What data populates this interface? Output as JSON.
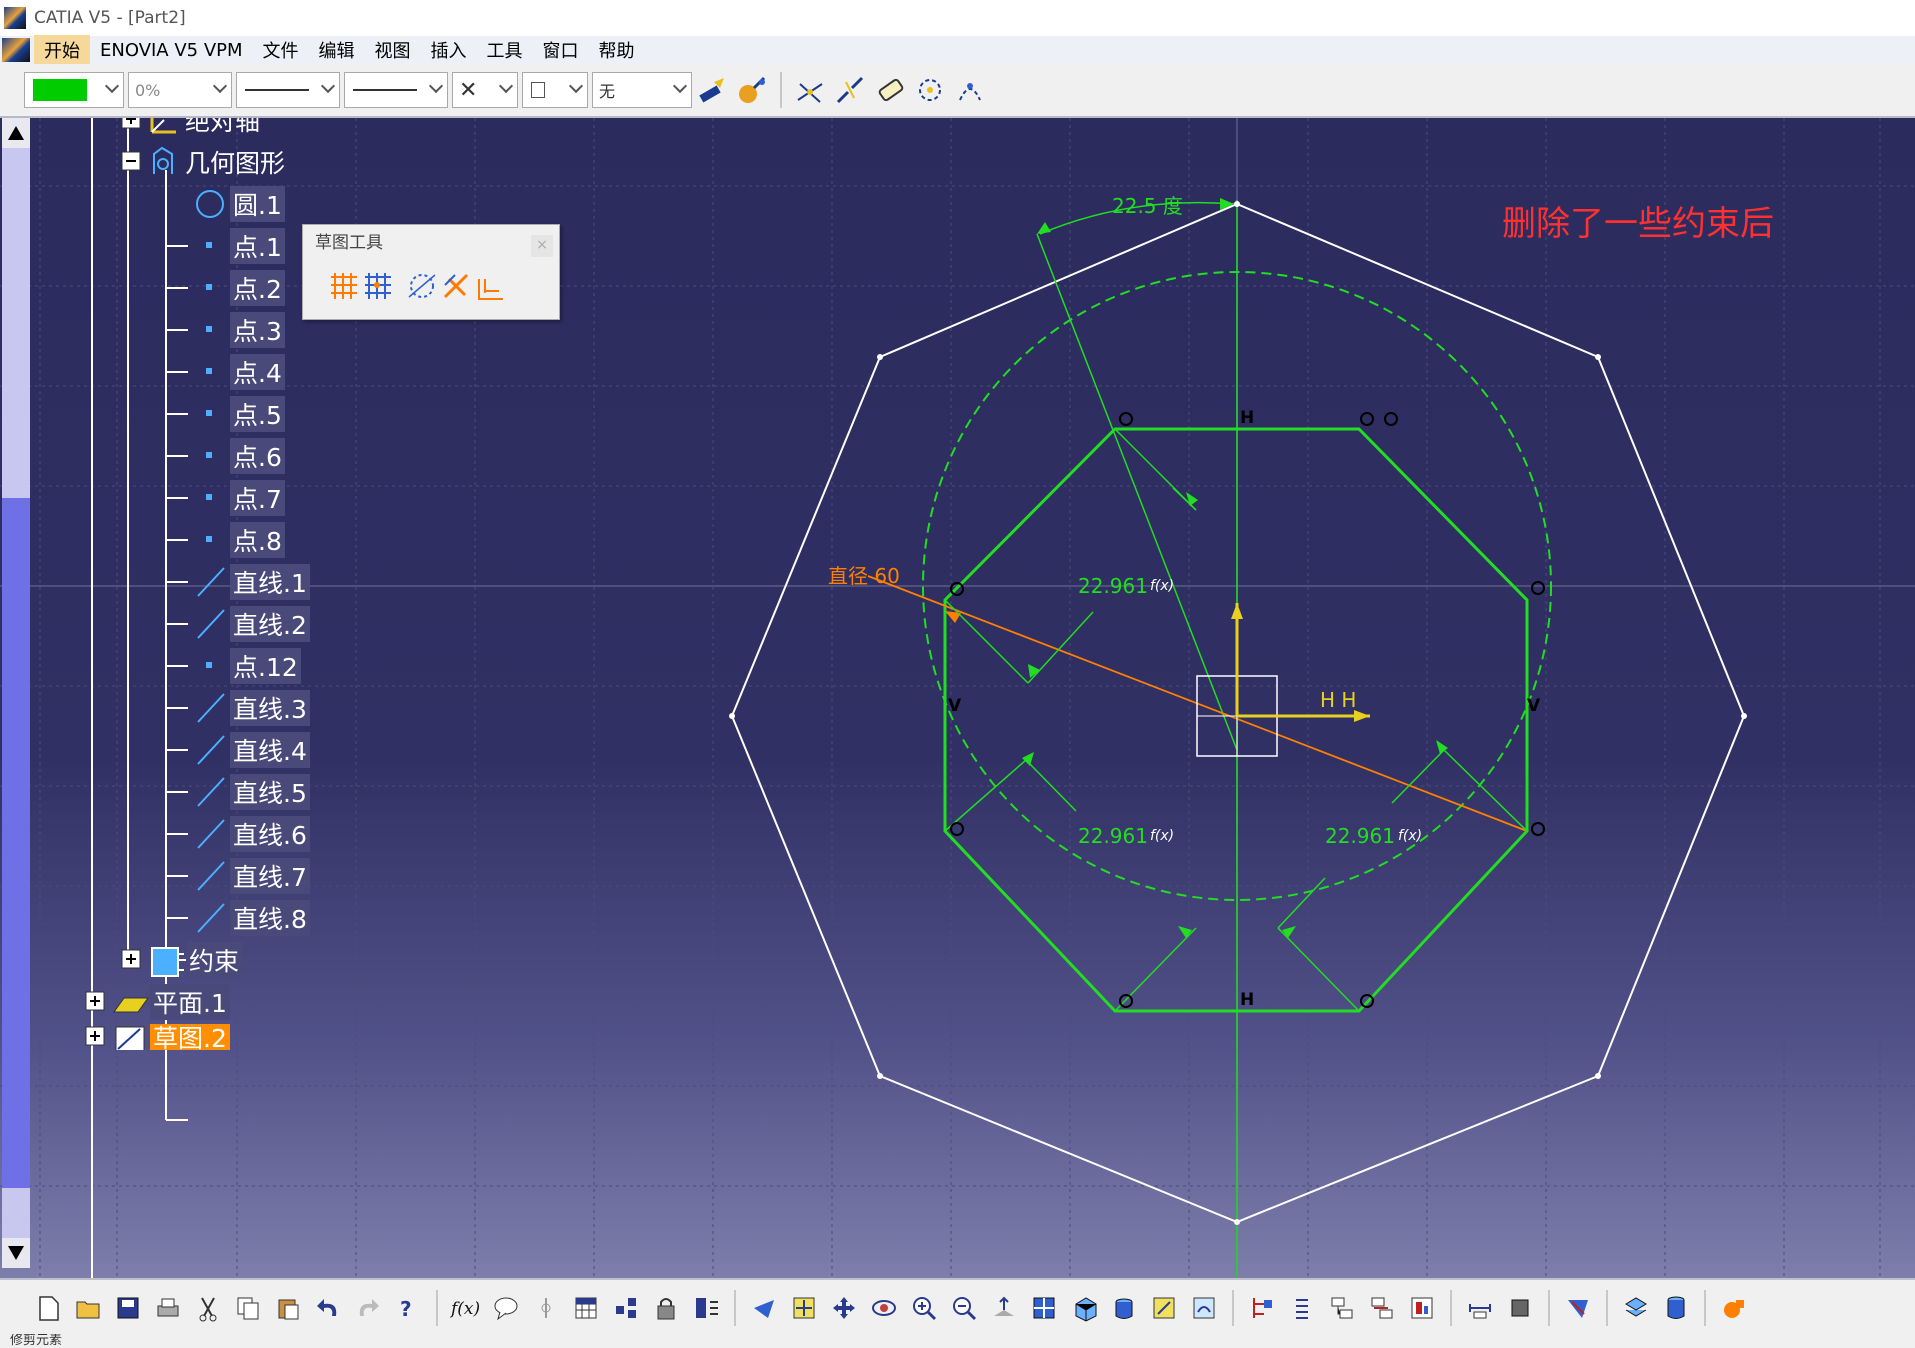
{
  "window": {
    "title": "CATIA V5 - [Part2]"
  },
  "menu": {
    "items": [
      "开始",
      "ENOVIA V5 VPM",
      "文件",
      "编辑",
      "视图",
      "插入",
      "工具",
      "窗口",
      "帮助"
    ]
  },
  "toolbar": {
    "color_value": "",
    "transparency": "0%",
    "line_type": "",
    "line_weight": "",
    "point_type": "",
    "layer": "无"
  },
  "tree": {
    "absolute_axis": "绝对轴",
    "geometry": "几何图形",
    "items": [
      "圆.1",
      "点.1",
      "点.2",
      "点.3",
      "点.4",
      "点.5",
      "点.6",
      "点.7",
      "点.8",
      "直线.1",
      "直线.2",
      "点.12",
      "直线.3",
      "直线.4",
      "直线.5",
      "直线.6",
      "直线.7",
      "直线.8"
    ],
    "constraints": "约束",
    "plane": "平面.1",
    "sketch": "草图.2"
  },
  "sketch_tools": {
    "title": "草图工具",
    "close": "×"
  },
  "annotation": "删除了一些约束后",
  "dimensions": {
    "angle": "22.5 度",
    "diameter": "直径 60",
    "distance_1": "22.961",
    "distance_2": "22.961",
    "distance_3": "22.961",
    "formula_mark": "f(x)"
  },
  "constraint_marks": {
    "horizontal": "H",
    "vertical": "V",
    "hh": "H H"
  },
  "status": {
    "text": "修剪元素"
  },
  "colors": {
    "sketch_green": "#22dd22",
    "background_top": "#2b2b5e",
    "annotation_red": "#ff3030",
    "dimension_orange": "#ff8000",
    "highlight_orange": "#ff8f00"
  }
}
